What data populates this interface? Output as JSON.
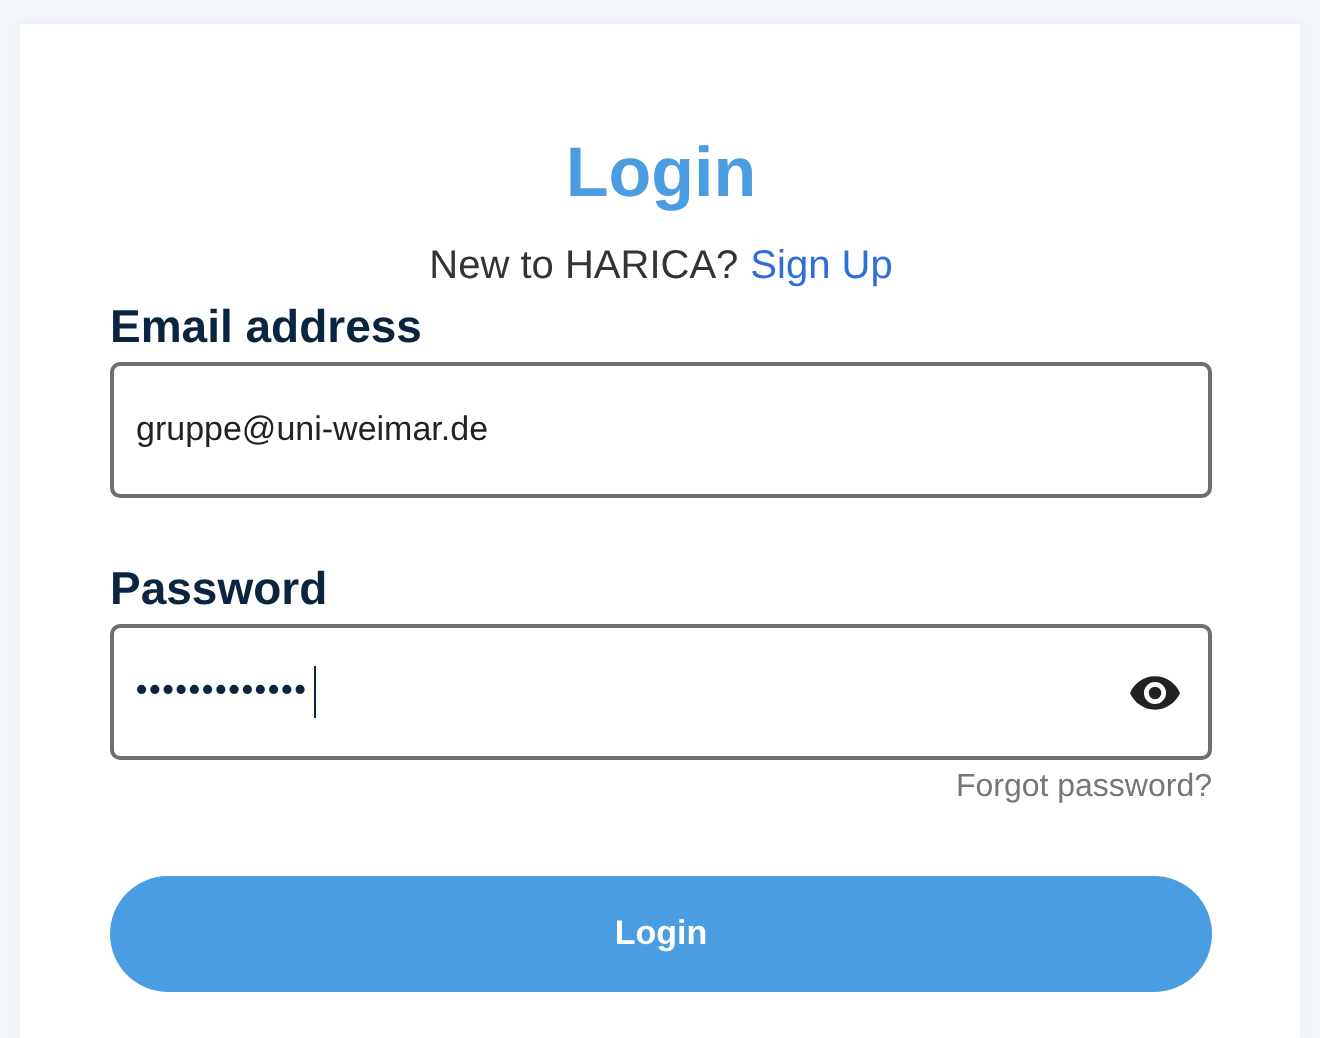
{
  "title": "Login",
  "signup": {
    "prompt": "New to HARICA?",
    "link": "Sign Up"
  },
  "email": {
    "label": "Email address",
    "value": "gruppe@uni-weimar.de"
  },
  "password": {
    "label": "Password",
    "value": "•••••••••••••",
    "focused": true
  },
  "forgot_link": "Forgot password?",
  "submit": "Login"
}
